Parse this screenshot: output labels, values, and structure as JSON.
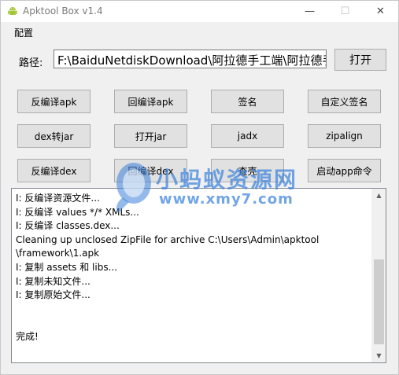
{
  "window": {
    "title": "Apktool Box v1.4",
    "controls": {
      "minimize": "—",
      "maximize": "☐",
      "close": "✕"
    }
  },
  "menu": {
    "config": "配置"
  },
  "path": {
    "label": "路径:",
    "value": "F:\\BaiduNetdiskDownload\\阿拉德手工端\\阿拉德手工",
    "open_button": "打开"
  },
  "buttons": {
    "row1": [
      "反编译apk",
      "回编译apk",
      "签名",
      "自定义签名"
    ],
    "row2": [
      "dex转jar",
      "打开jar",
      "jadx",
      "zipalign"
    ],
    "row3": [
      "反编译dex",
      "回编译dex",
      "查壳",
      "启动app命令"
    ]
  },
  "log": {
    "lines": [
      "I: 反编译资源文件...",
      "I: 反编译 values */* XMLs...",
      "I: 反编译 classes.dex...",
      "Cleaning up unclosed ZipFile for archive C:\\Users\\Admin\\apktool",
      "\\framework\\1.apk",
      "I: 复制 assets 和 libs...",
      "I: 复制未知文件...",
      "I: 复制原始文件...",
      "",
      "",
      "完成!"
    ]
  },
  "watermark": {
    "line1": "小蚂蚁资源网",
    "line2": "www.xmy7.com",
    "color": "#3c82dc"
  },
  "colors": {
    "button_bg": "#e1e1e1",
    "button_border": "#adadad",
    "window_bg": "#f0f0f0",
    "android_green": "#a4c639"
  },
  "icons": {
    "app": "android-icon",
    "scroll_up": "scroll-up-arrow-icon",
    "scroll_down": "scroll-down-arrow-icon"
  }
}
